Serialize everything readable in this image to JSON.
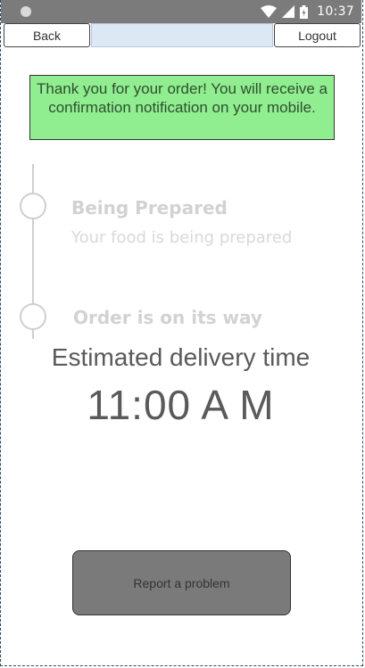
{
  "status_bar": {
    "time": "10:37",
    "icons": [
      "wifi-icon",
      "signal-icon",
      "battery-icon"
    ],
    "background": "#7b7b7b"
  },
  "toolbar": {
    "back_label": "Back",
    "logout_label": "Logout"
  },
  "confirmation": {
    "message": "Thank you for your order! You will receive a confirmation notification on your mobile.",
    "background": "#90ee90"
  },
  "timeline": {
    "steps": [
      {
        "title": "Being Prepared",
        "subtitle": "Your food is being prepared"
      },
      {
        "title": "Order is on its way",
        "subtitle": ""
      }
    ]
  },
  "delivery": {
    "label": "Estimated delivery time",
    "time": "11:00 A M"
  },
  "actions": {
    "report_label": "Report a problem"
  }
}
